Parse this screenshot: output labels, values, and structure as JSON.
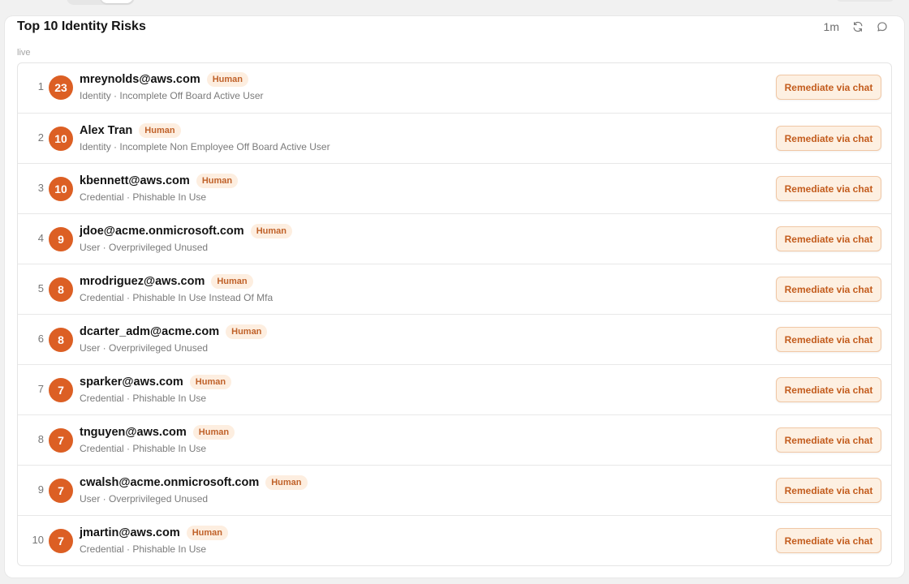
{
  "card": {
    "title": "Top 10 Identity Risks",
    "live_label": "live",
    "refresh_interval": "1m"
  },
  "colors": {
    "score_badge": "#dc5f24",
    "type_badge_bg": "#fdeee0",
    "type_badge_text": "#c0622a",
    "action_button_bg": "#fdf0e2",
    "action_button_text": "#c35c1d"
  },
  "icons": {
    "refresh": "refresh-icon",
    "chat": "chat-bubble-icon"
  },
  "risks": [
    {
      "rank": "1",
      "score": "23",
      "name": "mreynolds@aws.com",
      "type": "Human",
      "detail": "Identity · Incomplete Off Board Active User",
      "action": "Remediate via chat"
    },
    {
      "rank": "2",
      "score": "10",
      "name": "Alex Tran",
      "type": "Human",
      "detail": "Identity · Incomplete Non Employee Off Board Active User",
      "action": "Remediate via chat"
    },
    {
      "rank": "3",
      "score": "10",
      "name": "kbennett@aws.com",
      "type": "Human",
      "detail": "Credential · Phishable In Use",
      "action": "Remediate via chat"
    },
    {
      "rank": "4",
      "score": "9",
      "name": "jdoe@acme.onmicrosoft.com",
      "type": "Human",
      "detail": "User · Overprivileged Unused",
      "action": "Remediate via chat"
    },
    {
      "rank": "5",
      "score": "8",
      "name": "mrodriguez@aws.com",
      "type": "Human",
      "detail": "Credential · Phishable In Use Instead Of Mfa",
      "action": "Remediate via chat"
    },
    {
      "rank": "6",
      "score": "8",
      "name": "dcarter_adm@acme.com",
      "type": "Human",
      "detail": "User · Overprivileged Unused",
      "action": "Remediate via chat"
    },
    {
      "rank": "7",
      "score": "7",
      "name": "sparker@aws.com",
      "type": "Human",
      "detail": "Credential · Phishable In Use",
      "action": "Remediate via chat"
    },
    {
      "rank": "8",
      "score": "7",
      "name": "tnguyen@aws.com",
      "type": "Human",
      "detail": "Credential · Phishable In Use",
      "action": "Remediate via chat"
    },
    {
      "rank": "9",
      "score": "7",
      "name": "cwalsh@acme.onmicrosoft.com",
      "type": "Human",
      "detail": "User · Overprivileged Unused",
      "action": "Remediate via chat"
    },
    {
      "rank": "10",
      "score": "7",
      "name": "jmartin@aws.com",
      "type": "Human",
      "detail": "Credential · Phishable In Use",
      "action": "Remediate via chat"
    }
  ]
}
